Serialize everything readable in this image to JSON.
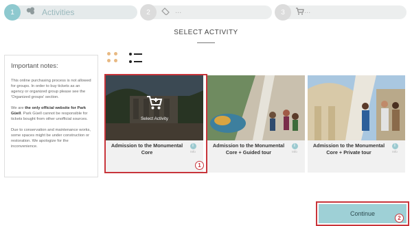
{
  "stepper": {
    "step1": {
      "number": "1",
      "label": "Activities",
      "icon": "tickets-icon"
    },
    "step2": {
      "number": "2",
      "label": "...",
      "icon": "ticket-icon"
    },
    "step3": {
      "number": "3",
      "label": "...",
      "icon": "cart-icon"
    }
  },
  "page_title": "SELECT ACTIVITY",
  "notes": {
    "title": "Important notes:",
    "para1": "This online purchasing process is not allowed for groups. In order to buy tickets as an agency or organized group please see the 'Organized groups' section.",
    "para2_prefix": "We are ",
    "para2_bold1": "the only official website for Park Güell",
    "para2_suffix": ". Park Güell cannot be responsible for tickets bought from other unofficial sources.",
    "para3": "Due to conservation and maintenance works, some spaces might be under construction or restoration. We apologize for the inconvenience."
  },
  "view": {
    "grid_icon": "grid-view-icon",
    "list_icon": "list-view-icon"
  },
  "cards": [
    {
      "title": "Admission to the Monumental Core",
      "info_symbol": "i",
      "info_label": "Info",
      "overlay_label": "Select Activity"
    },
    {
      "title": "Admission to the Monumental Core + Guided tour",
      "info_symbol": "i",
      "info_label": "Info"
    },
    {
      "title": "Admission to the Monumental Core + Private tour",
      "info_symbol": "i",
      "info_label": "Info"
    }
  ],
  "annotations": {
    "badge1": "1",
    "badge2": "2"
  },
  "continue_label": "Continue",
  "colors": {
    "accent": "#8ec9cf",
    "button": "#9ed0d6",
    "highlight": "#c8343a",
    "grid_dots": "#e8b982"
  }
}
